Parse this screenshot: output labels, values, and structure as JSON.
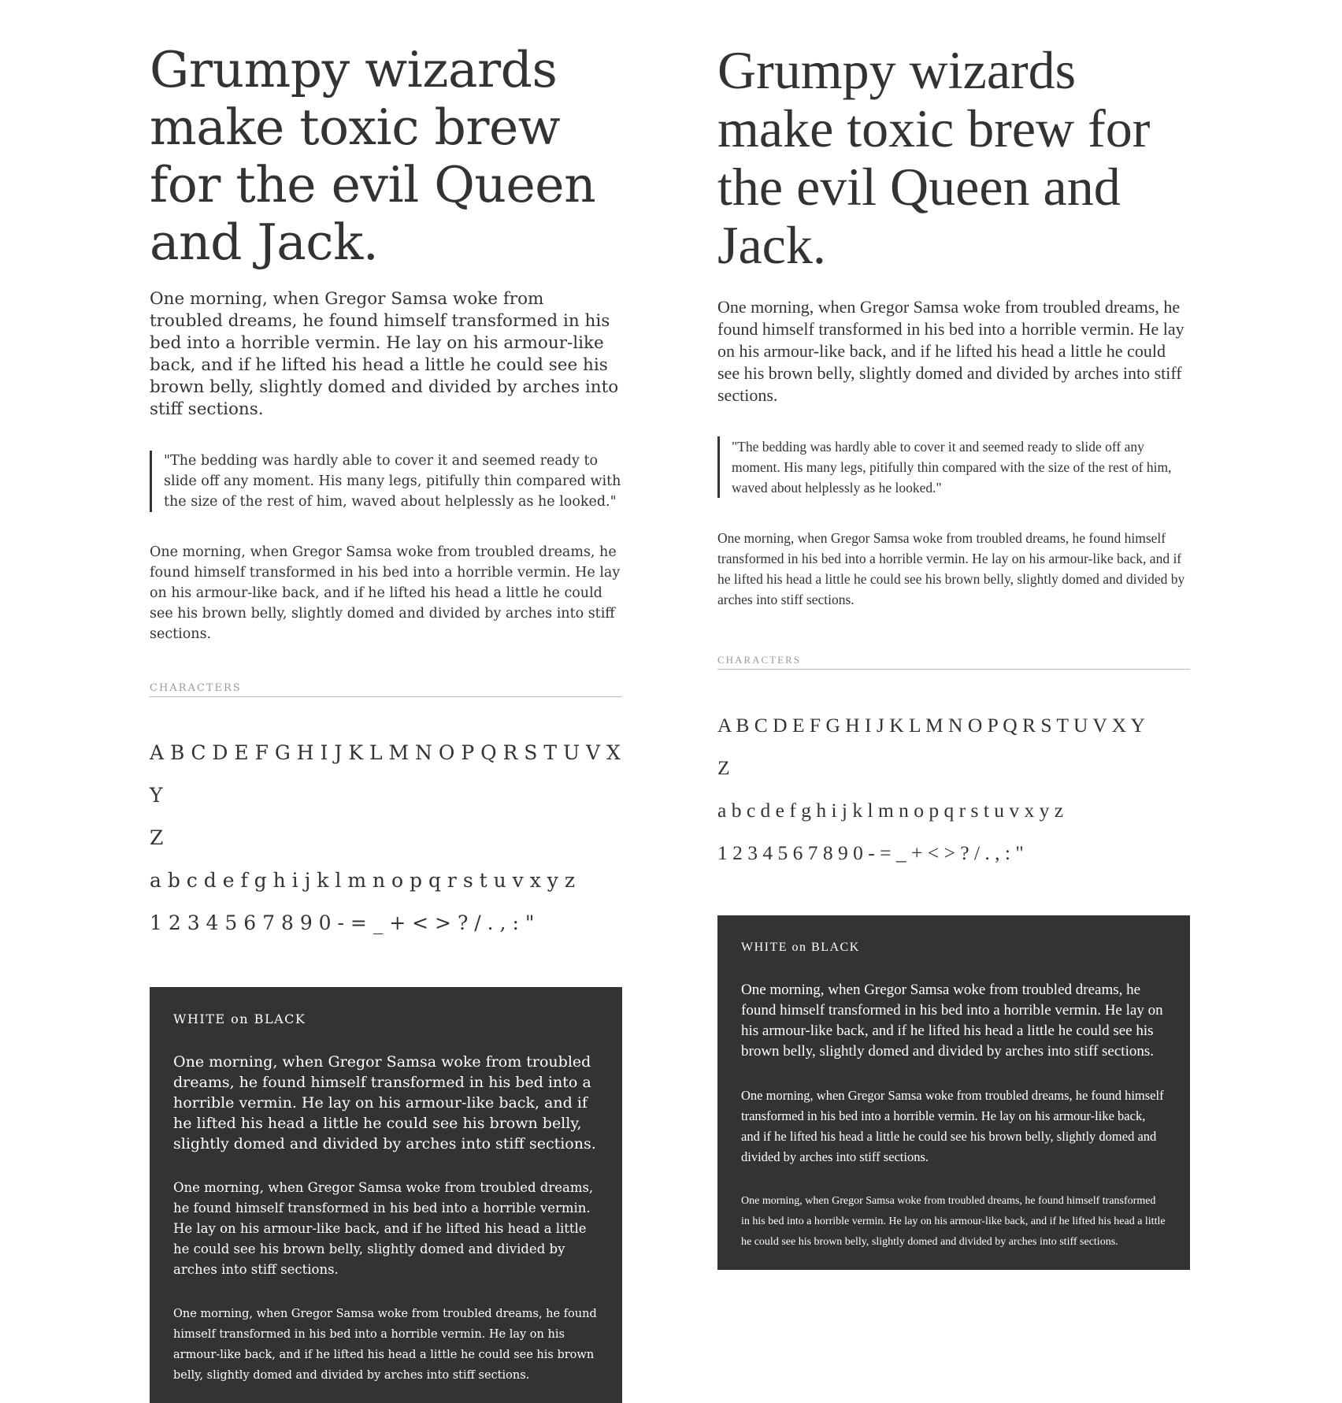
{
  "left": {
    "headline": "Grumpy wizards make toxic brew for the evil Queen and Jack.",
    "lead": "One morning, when Gregor Samsa woke from troubled dreams, he found himself transformed in his bed into a horrible vermin. He lay on his armour-like back, and if he lifted his head a little he could see his brown belly, slightly domed and divided by arches into stiff sections.",
    "quote": "\"The bedding was hardly able to cover it and seemed ready to slide off any moment. His many legs, pitifully thin compared with the size of the rest of him, waved about helplessly as he looked.\"",
    "body": "One morning, when Gregor Samsa woke from troubled dreams, he found himself transformed in his bed into a horrible vermin. He lay on his armour-like back, and if he lifted his head a little he could see his brown belly, slightly domed and divided by arches into stiff sections.",
    "characters_label": "CHARACTERS",
    "uppercase_line1": "A B C D E F G H I J K L M N O P Q R S T U V X Y",
    "uppercase_line2": "Z",
    "lowercase": "a b c d e f g h i j k l m n o p q r s t u v x y z",
    "numerals": "1 2 3 4 5 6 7 8 9 0 - = _ + < > ? / . , : \"",
    "dark": {
      "label": "WHITE on BLACK",
      "large": "One morning, when Gregor Samsa woke from troubled dreams, he found himself transformed in his bed into a horrible vermin. He lay on his armour-like back, and if he lifted his head a little he could see his brown belly, slightly domed and divided by arches into stiff sections.",
      "medium": "One morning, when Gregor Samsa woke from troubled dreams, he found himself transformed in his bed into a horrible vermin. He lay on his armour-like back, and if he lifted his head a little he could see his brown belly, slightly domed and divided by arches into stiff sections.",
      "small": "One morning, when Gregor Samsa woke from troubled dreams, he found himself transformed in his bed into a horrible vermin. He lay on his armour-like back, and if he lifted his head a little he could see his brown belly, slightly domed and divided by arches into stiff sections."
    }
  },
  "right": {
    "headline": "Grumpy wizards make toxic brew for the evil Queen and Jack.",
    "lead": "One morning, when Gregor Samsa woke from troubled dreams, he found himself transformed in his bed into a horrible vermin. He lay on his armour-like back, and if he lifted his head a little he could see his brown belly, slightly domed and divided by arches into stiff sections.",
    "quote": "\"The bedding was hardly able to cover it and seemed ready to slide off any moment. His many legs, pitifully thin compared with the size of the rest of him, waved about helplessly as he looked.\"",
    "body": "One morning, when Gregor Samsa woke from troubled dreams, he found himself transformed in his bed into a horrible vermin. He lay on his armour-like back, and if he lifted his head a little he could see his brown belly, slightly domed and divided by arches into stiff sections.",
    "characters_label": "CHARACTERS",
    "uppercase_line1": "A B C D E F G H I J K L M N O P Q R S T U V X Y",
    "uppercase_line2": "Z",
    "lowercase": "a b c d e f g h i j k l m n o p q r s t u v x y z",
    "numerals": "1 2 3 4 5 6 7 8 9 0 - = _ + < > ? / . , : \"",
    "dark": {
      "label": "WHITE on BLACK",
      "large": "One morning, when Gregor Samsa woke from troubled dreams, he found himself transformed in his bed into a horrible vermin. He lay on his armour-like back, and if he lifted his head a little he could see his brown belly, slightly domed and divided by arches into stiff sections.",
      "medium": "One morning, when Gregor Samsa woke from troubled dreams, he found himself transformed in his bed into a horrible vermin. He lay on his armour-like back, and if he lifted his head a little he could see his brown belly, slightly domed and divided by arches into stiff sections.",
      "small": "One morning, when Gregor Samsa woke from troubled dreams, he found himself transformed in his bed into a horrible vermin. He lay on his armour-like back, and if he lifted his head a little he could see his brown belly, slightly domed and divided by arches into stiff sections."
    }
  },
  "colors": {
    "text": "#333333",
    "panel_background": "#333333",
    "panel_text": "#ffffff",
    "label_gray": "#9a9a9a",
    "rule_gray": "#bbbbbb"
  }
}
